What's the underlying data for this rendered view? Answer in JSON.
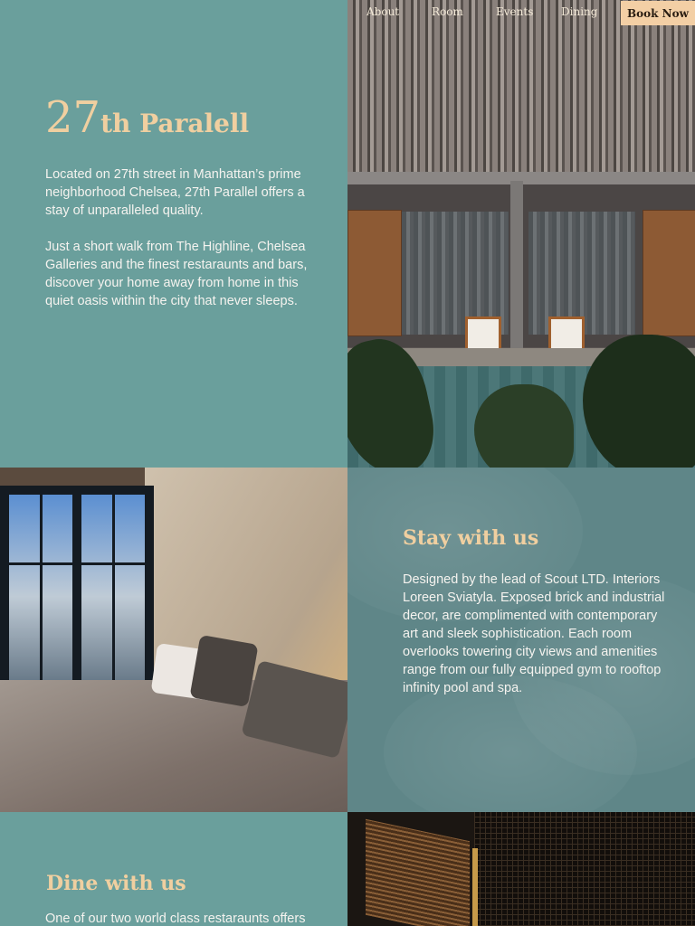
{
  "nav": {
    "items": [
      "About",
      "Room",
      "Events",
      "Dining"
    ],
    "book_label": "Book Now"
  },
  "hero": {
    "title_number": "27",
    "title_rest": "th Paralell",
    "para1": "Located on 27th street in Manhattan’s prime neighborhood Chelsea, 27th Parallel offers a stay of unparalleled quality.",
    "para2": "Just a short walk from The Highline, Chelsea Galleries and the finest restaraunts and bars, discover your home away from home in this quiet oasis within the city that never sleeps."
  },
  "stay": {
    "heading": "Stay with us",
    "body": "Designed by the lead of Scout LTD. Interiors Loreen Sviatyla. Exposed brick and industrial decor, are complimented with contemporary art and sleek sophistication. Each room overlooks towering city views and amenities range from our fully equipped gym to rooftop infinity pool and spa."
  },
  "dine": {
    "heading": "Dine with us",
    "body": "One of our two world class restaraunts offers"
  },
  "colors": {
    "teal": "#6a9f9c",
    "accent_gold": "#f0cfa0",
    "book_button": "#f3cfa5"
  }
}
